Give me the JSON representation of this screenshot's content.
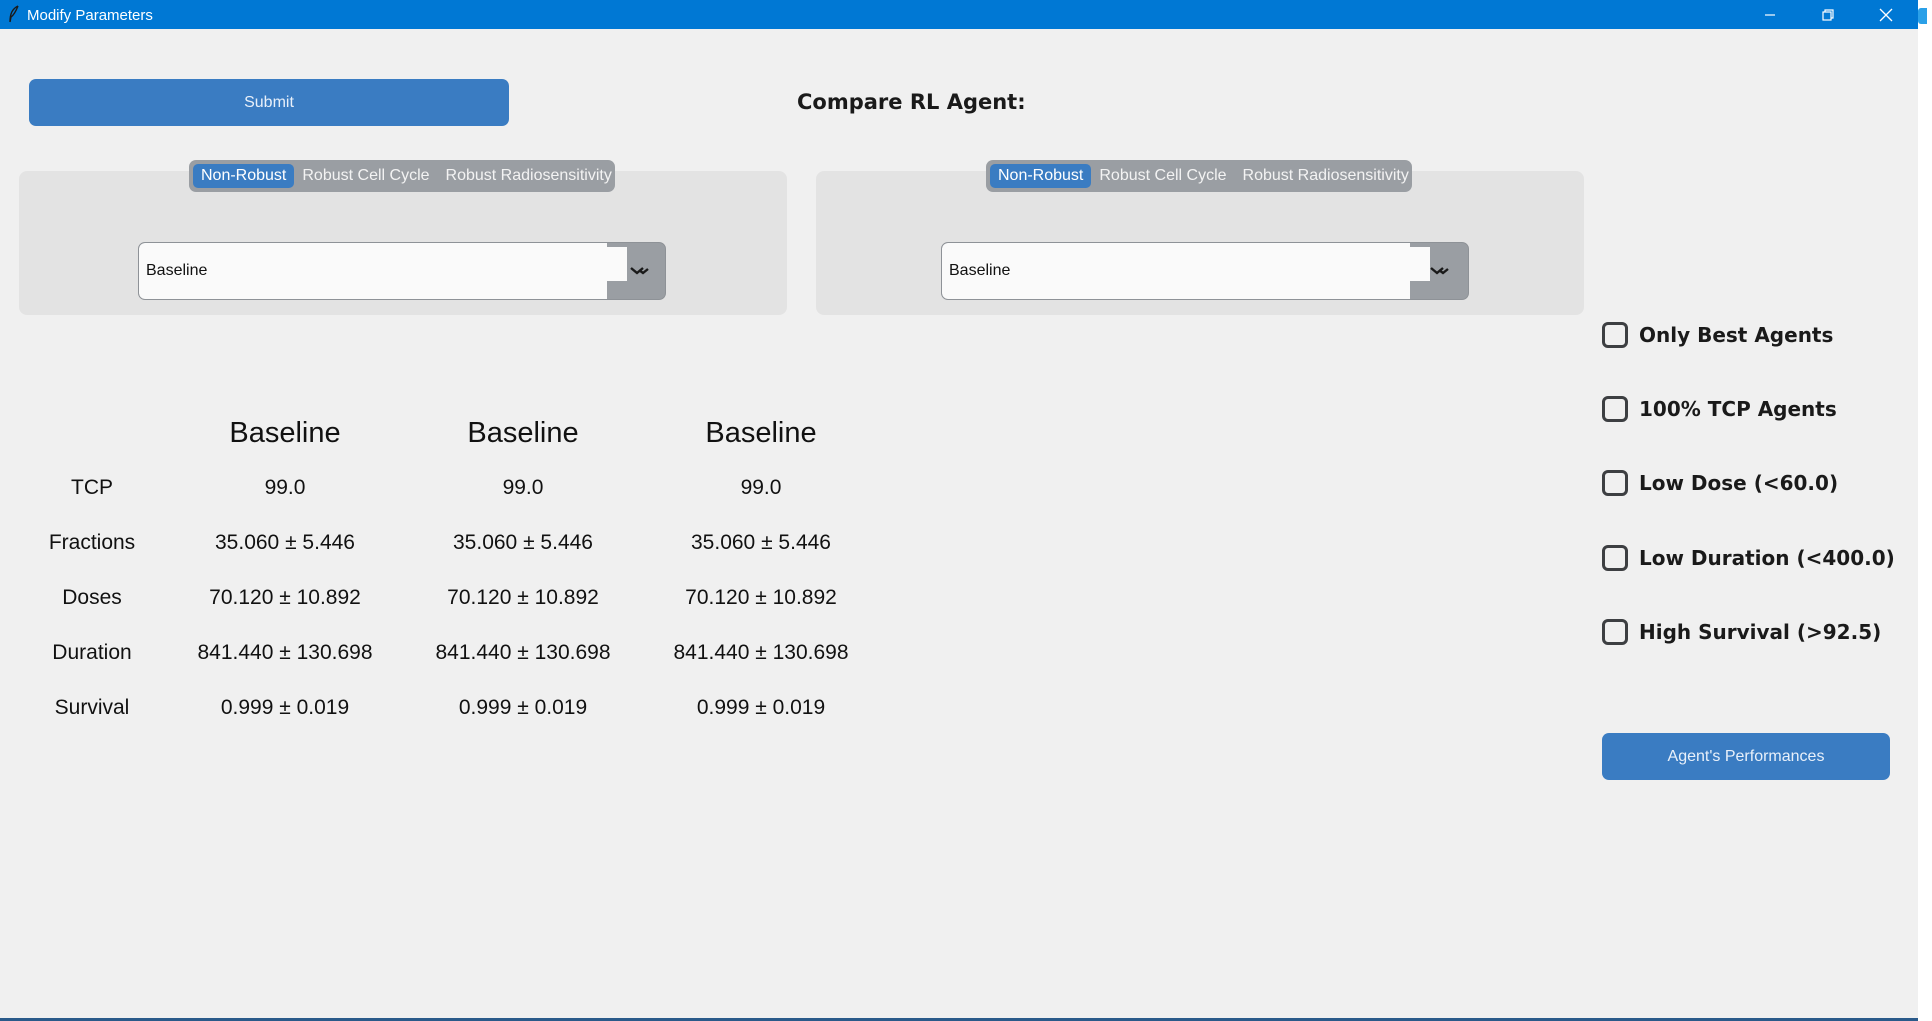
{
  "window": {
    "title": "Modify Parameters",
    "controls": {
      "minimize_icon": "minimize-icon",
      "restore_icon": "restore-icon",
      "close_icon": "close-icon"
    }
  },
  "toolbar": {
    "submit_label": "Submit",
    "compare_label": "Compare RL Agent:"
  },
  "left_panel": {
    "segments": [
      "Non-Robust",
      "Robust Cell Cycle",
      "Robust Radiosensitivity"
    ],
    "active_segment": "Non-Robust",
    "combo_value": "Baseline"
  },
  "right_panel": {
    "segments": [
      "Non-Robust",
      "Robust Cell Cycle",
      "Robust Radiosensitivity"
    ],
    "active_segment": "Non-Robust",
    "combo_value": "Baseline"
  },
  "results": {
    "columns": [
      "Baseline",
      "Baseline",
      "Baseline"
    ],
    "rows": [
      {
        "label": "TCP",
        "values": [
          "99.0",
          "99.0",
          "99.0"
        ]
      },
      {
        "label": "Fractions",
        "values": [
          "35.060 ± 5.446",
          "35.060 ± 5.446",
          "35.060 ± 5.446"
        ]
      },
      {
        "label": "Doses",
        "values": [
          "70.120 ± 10.892",
          "70.120 ± 10.892",
          "70.120 ± 10.892"
        ]
      },
      {
        "label": "Duration",
        "values": [
          "841.440 ± 130.698",
          "841.440 ± 130.698",
          "841.440 ± 130.698"
        ]
      },
      {
        "label": "Survival",
        "values": [
          "0.999 ± 0.019",
          "0.999 ± 0.019",
          "0.999 ± 0.019"
        ]
      }
    ]
  },
  "filters": [
    {
      "label": "Only Best Agents",
      "checked": false
    },
    {
      "label": "100% TCP Agents",
      "checked": false
    },
    {
      "label": "Low Dose (<60.0)",
      "checked": false
    },
    {
      "label": "Low Duration (<400.0)",
      "checked": false
    },
    {
      "label": "High Survival (>92.5)",
      "checked": false
    }
  ],
  "performance_button": "Agent's Performances",
  "colors": {
    "titlebar": "#0078d4",
    "accent": "#3a7cc2",
    "background": "#f0f0f0"
  }
}
